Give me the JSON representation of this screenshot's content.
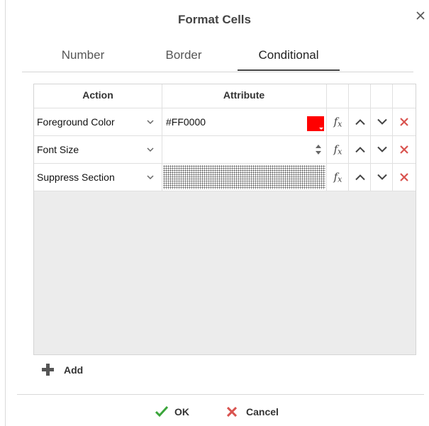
{
  "dialog": {
    "title": "Format Cells"
  },
  "tabs": [
    {
      "label": "Number",
      "active": false
    },
    {
      "label": "Border",
      "active": false
    },
    {
      "label": "Conditional",
      "active": true
    }
  ],
  "grid": {
    "headers": {
      "action": "Action",
      "attribute": "Attribute"
    },
    "rows": [
      {
        "action": "Foreground Color",
        "attribute": "#FF0000",
        "attribute_type": "color",
        "swatch_color": "#ff0000"
      },
      {
        "action": "Font Size",
        "attribute": "",
        "attribute_type": "number"
      },
      {
        "action": "Suppress Section",
        "attribute": "",
        "attribute_type": "disabled"
      }
    ],
    "row_icons": [
      "fx-icon",
      "chevron-up-icon",
      "chevron-down-icon",
      "delete-icon"
    ]
  },
  "add": {
    "label": "Add"
  },
  "footer": {
    "ok_label": "OK",
    "cancel_label": "Cancel"
  },
  "colors": {
    "ok_check": "#3aa53a",
    "delete_x": "#d9534f",
    "swatch": "#ff0000"
  }
}
